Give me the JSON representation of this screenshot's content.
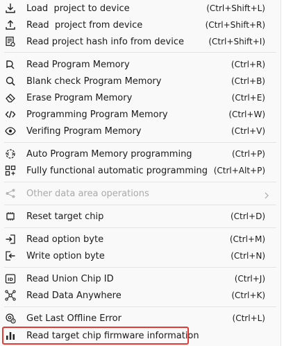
{
  "menu": {
    "items": [
      {
        "label": "Load  project to device",
        "shortcut": "(Ctrl+Shift+L)",
        "icon": "download-icon"
      },
      {
        "label": "Read  project from device",
        "shortcut": "(Ctrl+Shift+R)",
        "icon": "upload-icon"
      },
      {
        "label": "Read project hash info from device",
        "shortcut": "(Ctrl+Shift+I)",
        "icon": "hash-doc-icon"
      },
      {
        "label": "Read Program Memory",
        "shortcut": "(Ctrl+R)",
        "icon": "read-memory-icon"
      },
      {
        "label": "Blank check Program Memory",
        "shortcut": "(Ctrl+B)",
        "icon": "blank-check-icon"
      },
      {
        "label": "Erase Program Memory",
        "shortcut": "(Ctrl+E)",
        "icon": "eraser-icon"
      },
      {
        "label": "Programming Program Memory",
        "shortcut": "(Ctrl+W)",
        "icon": "code-icon"
      },
      {
        "label": "Verifing Program Memory",
        "shortcut": "(Ctrl+V)",
        "icon": "verify-eye-icon"
      },
      {
        "label": "Auto Program Memory programming",
        "shortcut": "(Ctrl+P)",
        "icon": "auto-program-icon"
      },
      {
        "label": "Fully functional automatic programming",
        "shortcut": "(Ctrl+Alt+P)",
        "icon": "grid-apps-icon"
      },
      {
        "label": "Other data area operations",
        "shortcut": "",
        "icon": "share-icon",
        "disabled": true
      },
      {
        "label": "Reset target chip",
        "shortcut": "(Ctrl+D)",
        "icon": "chip-icon"
      },
      {
        "label": "Read option byte",
        "shortcut": "(Ctrl+M)",
        "icon": "read-option-icon"
      },
      {
        "label": "Write option byte",
        "shortcut": "(Ctrl+N)",
        "icon": "write-option-icon"
      },
      {
        "label": "Read Union Chip ID",
        "shortcut": "(Ctrl+J)",
        "icon": "id-card-icon"
      },
      {
        "label": "Read Data Anywhere",
        "shortcut": "(Ctrl+K)",
        "icon": "network-icon"
      },
      {
        "label": "Get Last Offline Error",
        "shortcut": "(Ctrl+L)",
        "icon": "error-gear-icon"
      },
      {
        "label": "Read target chip firmware information",
        "shortcut": "",
        "icon": "bar-chart-icon",
        "highlighted": true
      }
    ]
  },
  "colors": {
    "highlight_border": "#e53935",
    "disabled_text": "#a9a9a9",
    "separator": "#e3e3e3"
  }
}
